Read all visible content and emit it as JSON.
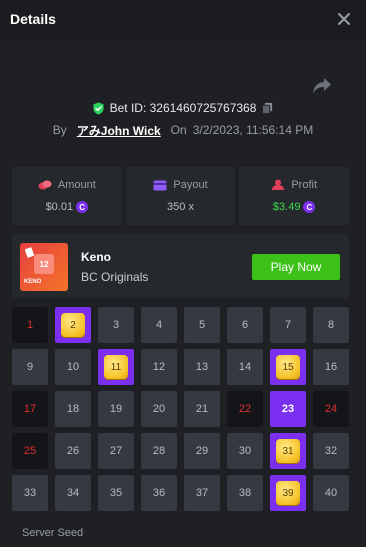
{
  "header": {
    "title": "Details"
  },
  "bet": {
    "id_text": "Bet ID: 3261460725767368",
    "by_label": "By",
    "user": "アみJohn Wick",
    "on_label": "On",
    "date": "3/2/2023, 11:56:14 PM"
  },
  "stats": {
    "amount": {
      "label": "Amount",
      "value": "$0.01"
    },
    "payout": {
      "label": "Payout",
      "value": "350 x"
    },
    "profit": {
      "label": "Profit",
      "value": "$3.49"
    }
  },
  "game": {
    "name": "Keno",
    "provider": "BC Originals",
    "play_label": "Play Now",
    "thumb_number": "12",
    "thumb_text": "KENO"
  },
  "grid": [
    {
      "n": "1",
      "state": "miss"
    },
    {
      "n": "2",
      "state": "hit"
    },
    {
      "n": "3",
      "state": "normal"
    },
    {
      "n": "4",
      "state": "normal"
    },
    {
      "n": "5",
      "state": "normal"
    },
    {
      "n": "6",
      "state": "normal"
    },
    {
      "n": "7",
      "state": "normal"
    },
    {
      "n": "8",
      "state": "normal"
    },
    {
      "n": "9",
      "state": "normal"
    },
    {
      "n": "10",
      "state": "normal"
    },
    {
      "n": "11",
      "state": "hit"
    },
    {
      "n": "12",
      "state": "normal"
    },
    {
      "n": "13",
      "state": "normal"
    },
    {
      "n": "14",
      "state": "normal"
    },
    {
      "n": "15",
      "state": "hit"
    },
    {
      "n": "16",
      "state": "normal"
    },
    {
      "n": "17",
      "state": "miss"
    },
    {
      "n": "18",
      "state": "normal"
    },
    {
      "n": "19",
      "state": "normal"
    },
    {
      "n": "20",
      "state": "normal"
    },
    {
      "n": "21",
      "state": "normal"
    },
    {
      "n": "22",
      "state": "miss"
    },
    {
      "n": "23",
      "state": "picked-miss"
    },
    {
      "n": "24",
      "state": "miss"
    },
    {
      "n": "25",
      "state": "miss"
    },
    {
      "n": "26",
      "state": "normal"
    },
    {
      "n": "27",
      "state": "normal"
    },
    {
      "n": "28",
      "state": "normal"
    },
    {
      "n": "29",
      "state": "normal"
    },
    {
      "n": "30",
      "state": "normal"
    },
    {
      "n": "31",
      "state": "hit"
    },
    {
      "n": "32",
      "state": "normal"
    },
    {
      "n": "33",
      "state": "normal"
    },
    {
      "n": "34",
      "state": "normal"
    },
    {
      "n": "35",
      "state": "normal"
    },
    {
      "n": "36",
      "state": "normal"
    },
    {
      "n": "37",
      "state": "normal"
    },
    {
      "n": "38",
      "state": "normal"
    },
    {
      "n": "39",
      "state": "hit"
    },
    {
      "n": "40",
      "state": "normal"
    }
  ],
  "footer": {
    "server_seed_label": "Server Seed"
  },
  "icons": {
    "close": "close-icon",
    "share": "share-icon",
    "shield": "shield-check-icon",
    "copy": "copy-icon",
    "amount": "chips-icon",
    "payout": "card-icon",
    "profit": "profit-icon",
    "coin": "coin-icon"
  },
  "colors": {
    "accent": "#7b2ff0",
    "play": "#3bc117",
    "profit": "#3ddc4e",
    "miss": "#e02f2f",
    "shield": "#2ad15a"
  }
}
